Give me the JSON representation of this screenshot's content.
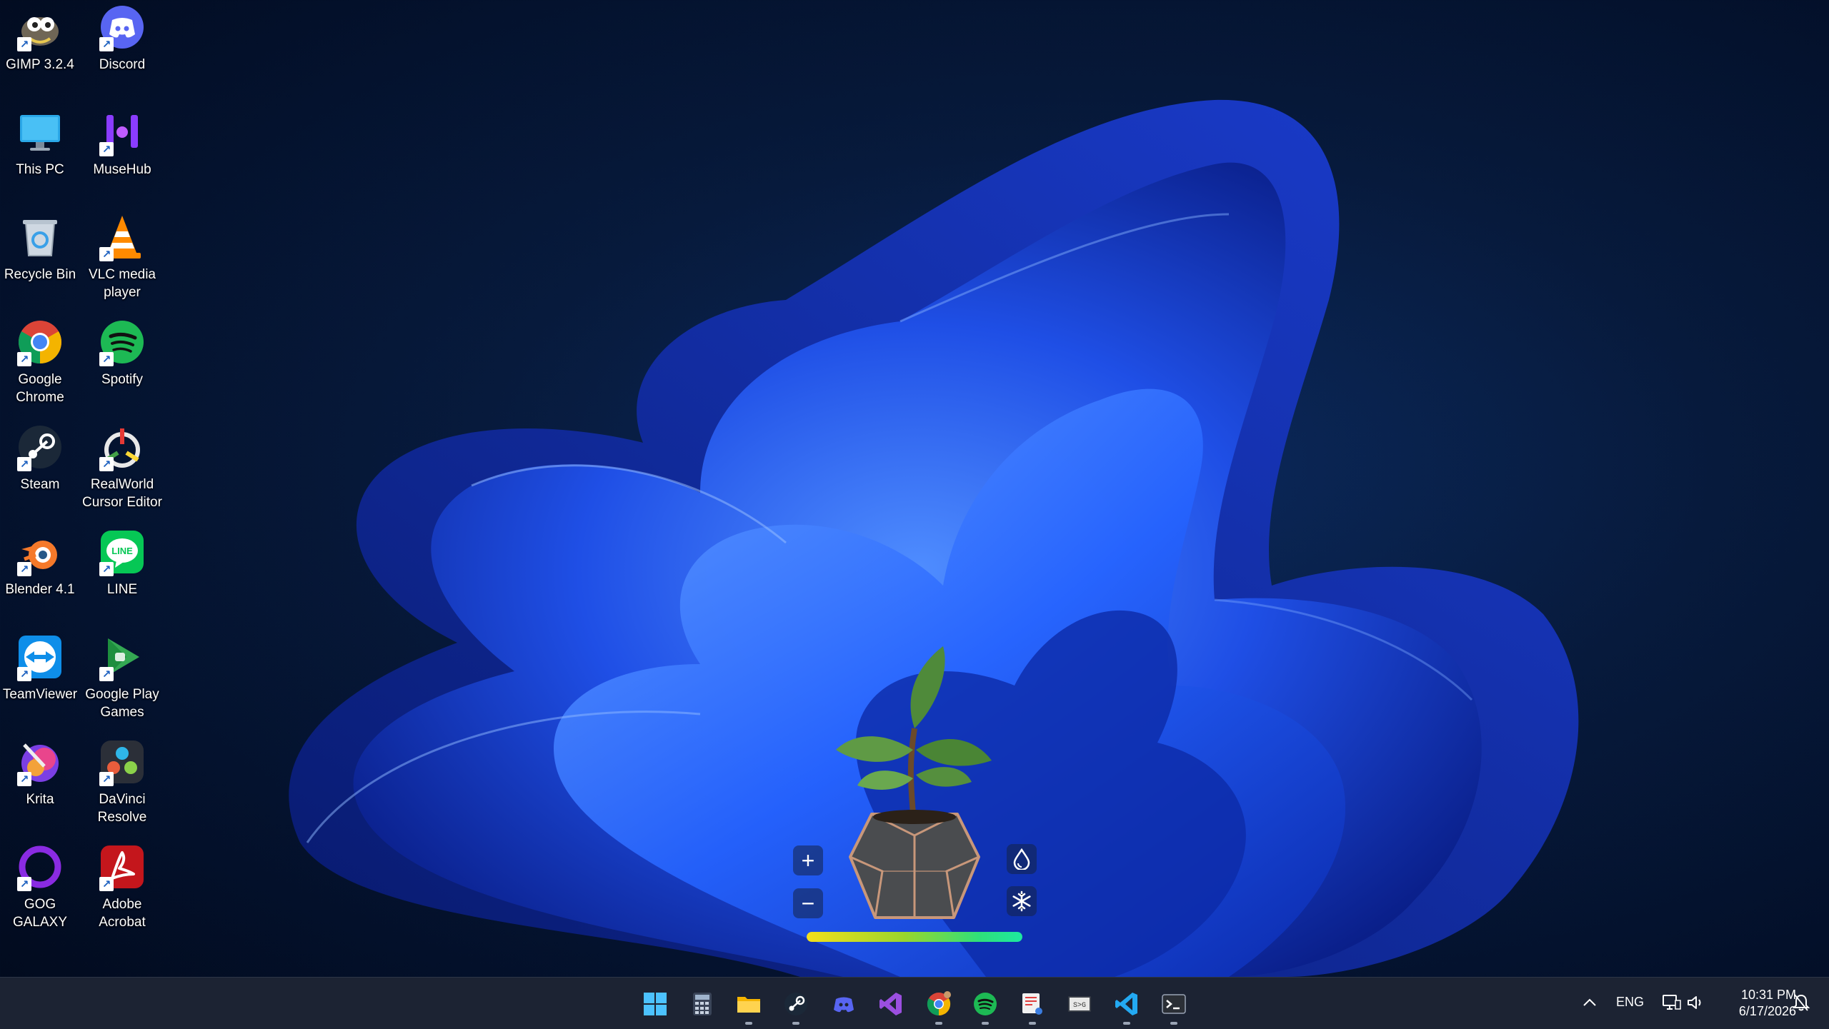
{
  "desktop": {
    "icons": [
      {
        "label": "GIMP 3.2.4"
      },
      {
        "label": "Discord"
      },
      {
        "label": "This PC"
      },
      {
        "label": "MuseHub"
      },
      {
        "label": "Recycle Bin"
      },
      {
        "label": "VLC media player"
      },
      {
        "label": "Google Chrome"
      },
      {
        "label": "Spotify"
      },
      {
        "label": "Steam"
      },
      {
        "label": "RealWorld Cursor Editor"
      },
      {
        "label": "Blender 4.1"
      },
      {
        "label": "LINE"
      },
      {
        "label": "TeamViewer"
      },
      {
        "label": "Google Play Games"
      },
      {
        "label": "Krita"
      },
      {
        "label": "DaVinci Resolve"
      },
      {
        "label": "GOG GALAXY"
      },
      {
        "label": "Adobe Acrobat"
      }
    ]
  },
  "plant_widget": {
    "add_symbol": "+",
    "remove_symbol": "−",
    "water_icon": "water-drop-icon",
    "freeze_icon": "snowflake-icon",
    "health_fraction": 1.0
  },
  "taskbar": {
    "apps": [
      {
        "name": "start",
        "icon": "windows-logo-icon"
      },
      {
        "name": "calculator",
        "icon": "calculator-icon"
      },
      {
        "name": "file-explorer",
        "icon": "folder-icon"
      },
      {
        "name": "steam",
        "icon": "steam-icon"
      },
      {
        "name": "discord",
        "icon": "discord-icon"
      },
      {
        "name": "visual-studio",
        "icon": "visual-studio-icon"
      },
      {
        "name": "chrome",
        "icon": "chrome-icon"
      },
      {
        "name": "spotify",
        "icon": "spotify-icon"
      },
      {
        "name": "snipping-tool",
        "icon": "snipping-tool-icon"
      },
      {
        "name": "svg-viewer",
        "icon": "svg-viewer-icon"
      },
      {
        "name": "vscode",
        "icon": "vscode-icon"
      },
      {
        "name": "terminal",
        "icon": "terminal-icon"
      }
    ],
    "tray": {
      "language": "ENG",
      "time": "10:31 PM",
      "date": "6/17/2026"
    }
  },
  "colors": {
    "taskbar_bg": "#1c2333",
    "wallpaper_accent": "#1f5bff"
  }
}
